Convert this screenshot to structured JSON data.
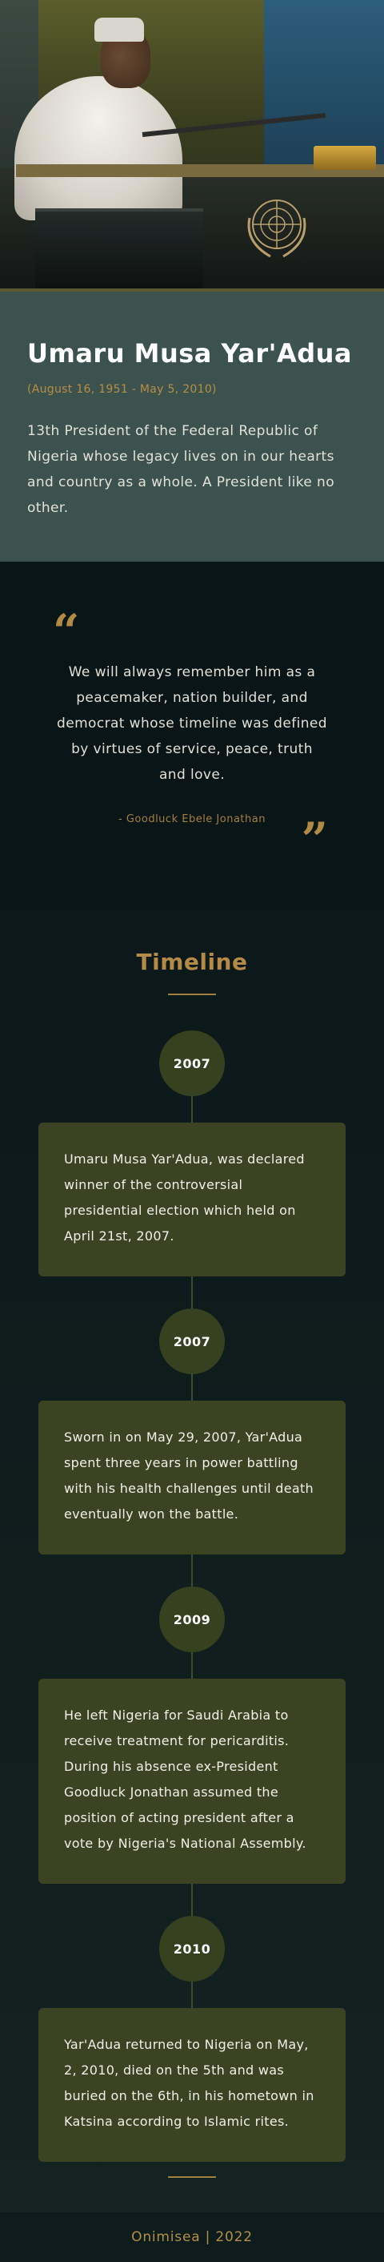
{
  "hero": {
    "image_alt": "Umaru Musa Yar'Adua speaking at a podium"
  },
  "intro": {
    "name": "Umaru Musa Yar'Adua",
    "dates": "(August 16, 1951 - May 5, 2010)",
    "description": "13th President of the Federal Republic of Nigeria whose legacy lives on in our hearts and country as a whole. A President like no other."
  },
  "quote": {
    "open_mark": "“",
    "text": "We will always remember him as a peacemaker, nation builder, and democrat whose timeline was defined by virtues of service, peace, truth and love.",
    "author": "- Goodluck Ebele Jonathan",
    "close_mark": "”"
  },
  "timeline": {
    "title": "Timeline",
    "events": [
      {
        "year": "2007",
        "text": "Umaru Musa Yar'Adua, was declared winner of the controversial presidential election which held on April 21st, 2007."
      },
      {
        "year": "2007",
        "text": "Sworn in on May 29, 2007, Yar'Adua spent three years in power battling with his health challenges until death eventually won the battle."
      },
      {
        "year": "2009",
        "text": "He left Nigeria for Saudi Arabia to receive treatment for pericarditis. During his absence ex-President Goodluck Jonathan assumed the position of acting president after a vote by Nigeria's National Assembly."
      },
      {
        "year": "2010",
        "text": "Yar'Adua returned to Nigeria on May, 2, 2010, died on the 5th and was buried on the 6th, in his hometown in Katsina according to Islamic rites."
      }
    ]
  },
  "footer": {
    "text": "Onimisea | 2022"
  },
  "colors": {
    "accent_gold": "#b38a46",
    "intro_bg": "#3c524e",
    "card_bg": "#3b4322",
    "page_bg": "#0b1517"
  }
}
